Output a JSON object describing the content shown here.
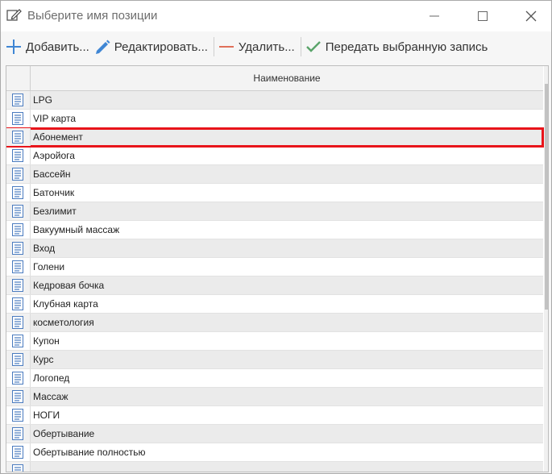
{
  "window": {
    "title": "Выберите имя позиции",
    "title_icon": "edit-icon"
  },
  "toolbar": {
    "add_label": "Добавить...",
    "edit_label": "Редактировать...",
    "delete_label": "Удалить...",
    "pass_label": "Передать выбранную запись"
  },
  "grid": {
    "column_name": "Наименование",
    "selected_index": 2,
    "rows": [
      {
        "name": "LPG"
      },
      {
        "name": "VIP карта"
      },
      {
        "name": "Абонемент"
      },
      {
        "name": "Аэройога"
      },
      {
        "name": "Бассейн"
      },
      {
        "name": "Батончик"
      },
      {
        "name": "Безлимит"
      },
      {
        "name": "Вакуумный массаж"
      },
      {
        "name": "Вход"
      },
      {
        "name": "Голени"
      },
      {
        "name": "Кедровая бочка"
      },
      {
        "name": "Клубная карта"
      },
      {
        "name": "косметология"
      },
      {
        "name": "Купон"
      },
      {
        "name": "Курс"
      },
      {
        "name": "Логопед"
      },
      {
        "name": "Массаж"
      },
      {
        "name": "НОГИ"
      },
      {
        "name": "Обертывание"
      },
      {
        "name": "Обертывание полностью"
      },
      {
        "name": ""
      }
    ]
  },
  "colors": {
    "selection_outline": "#e8141a",
    "add_icon": "#3f86d4",
    "edit_icon": "#3f86d4",
    "delete_icon": "#e0705a",
    "check_icon": "#5aa46a"
  }
}
